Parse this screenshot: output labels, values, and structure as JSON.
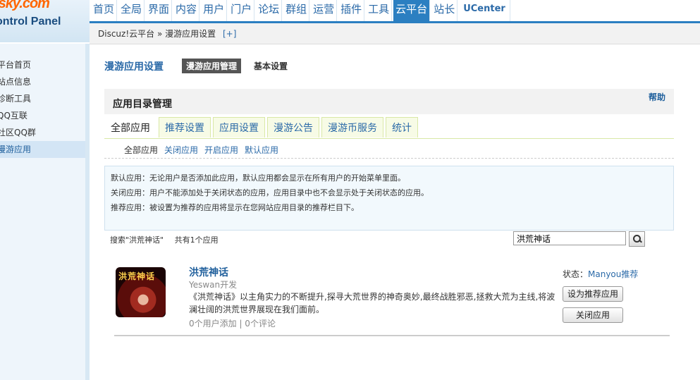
{
  "logo": {
    "brand": "fsky.com",
    "subtitle": "ontrol Panel"
  },
  "nav": [
    "首页",
    "全局",
    "界面",
    "内容",
    "用户",
    "门户",
    "论坛",
    "群组",
    "运营",
    "插件",
    "工具",
    "云平台",
    "站长",
    "UCenter"
  ],
  "nav_active": "云平台",
  "breadcrumb": {
    "text": "Discuz!云平台 » 漫游应用设置",
    "plus": "[+]"
  },
  "sidebar": {
    "items": [
      "平台首页",
      "站点信息",
      "诊断工具",
      "QQ互联",
      "社区QQ群",
      "漫游应用"
    ],
    "active": "漫游应用"
  },
  "page": {
    "title": "漫游应用设置",
    "subtab_active": "漫游应用管理",
    "subtab_other": "基本设置"
  },
  "section": {
    "heading": "应用目录管理",
    "help": "帮助"
  },
  "tabs": [
    "全部应用",
    "推荐设置",
    "应用设置",
    "漫游公告",
    "漫游币服务",
    "统计"
  ],
  "filters": [
    "全部应用",
    "关闭应用",
    "开启应用",
    "默认应用"
  ],
  "notice": [
    "默认应用：无论用户是否添加此应用，默认应用都会显示在所有用户的开始菜单里面。",
    "关闭应用：用户不能添加处于关闭状态的应用，应用目录中也不会显示处于关闭状态的应用。",
    "推荐应用：被设置为推荐的应用将显示在您网站应用目录的推荐栏目下。"
  ],
  "search": {
    "label": "搜索\"洪荒神话\"",
    "count": "共有1个应用",
    "value": "洪荒神话"
  },
  "app": {
    "icon_text": "洪荒神话",
    "name": "洪荒神话",
    "developer": "Yeswan开发",
    "description": "《洪荒神话》以主角实力的不断提升,探寻大荒世界的神奇奥妙,最终战胜邪恶,拯救大荒为主线,将波澜壮阔的洪荒世界展现在我们面前。",
    "meta": "0个用户添加 | 0个评论",
    "status_label": "状态：",
    "status_value": "Manyou推荐",
    "btn_recommend": "设为推荐应用",
    "btn_close": "关闭应用"
  }
}
